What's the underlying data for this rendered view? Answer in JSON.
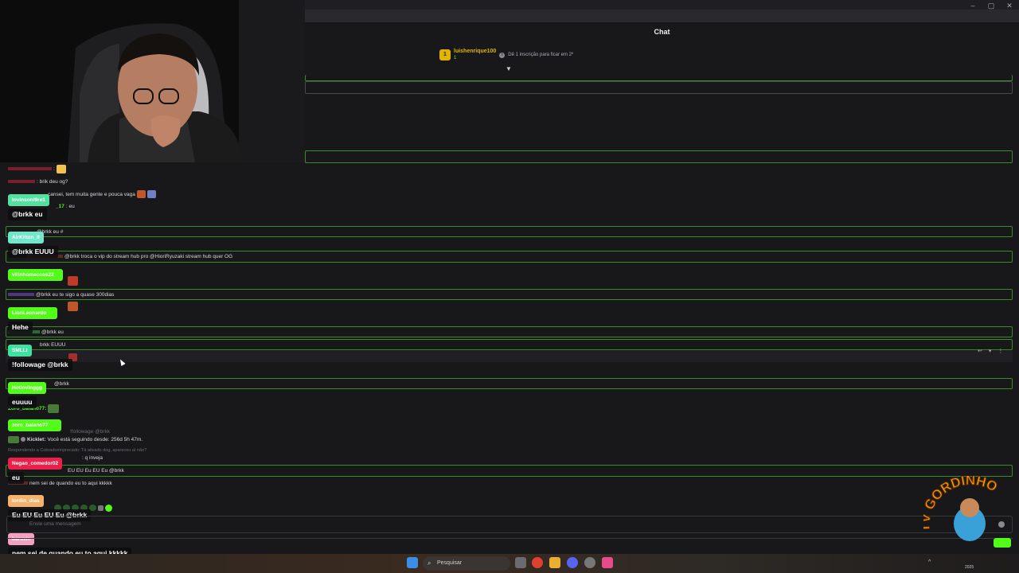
{
  "window": {
    "minimize_glyph": "–",
    "maximize_glyph": "▢",
    "close_glyph": "✕"
  },
  "chat": {
    "header": "Chat",
    "pinned": {
      "rank": "1",
      "username": "luishenrique100",
      "count": "1",
      "text": "Dê 1 inscrição para ficar em 2º"
    },
    "input_placeholder": "Envie uma mensagem",
    "messages": [
      {
        "user": "",
        "text": ":",
        "color": "#e94560"
      },
      {
        "user": "",
        "text": ": brik deu og?",
        "color": "#e94560"
      },
      {
        "user": "",
        "text": "cansei, tem muita gente e pouca vaga",
        "color": "#9a9aa0"
      },
      {
        "user": "_17",
        "text": ": eu",
        "color": "#53fc18"
      },
      {
        "user": "",
        "text": "@brkk eu #",
        "color": "#9a9aa0"
      },
      {
        "user": "",
        "text": "@brkk troca o vip do stream hub pro @HioriRyuzaki stream hub quer OG",
        "color": "#c85a5a"
      },
      {
        "user": "",
        "text": "@brkk eu te sigo a quase 300dias",
        "color": "#8a6fd8"
      },
      {
        "user": "",
        "text": "@brkk eu",
        "color": "#53fc18"
      },
      {
        "user": "",
        "text": "brkk EUUU",
        "color": "#53fc18"
      },
      {
        "user": "",
        "text": "@brkk",
        "color": "#53fc18"
      },
      {
        "user": "Zoro_baiano77:",
        "text": "",
        "color": "#53fc18"
      },
      {
        "user": "",
        "text": "!followage @brkk",
        "color": "#6b6b70"
      },
      {
        "user": "Kicklet:",
        "text": "Você está seguindo desde: 256d 5h 47m.",
        "color": "#d8d8dc"
      },
      {
        "user": "",
        "text": "Respondendo a Cobradorimprecado: Tá ativado dog, apareceu aí não?",
        "color": "#6b6b70"
      },
      {
        "user": "",
        "text": ": q inveja",
        "color": "#6b6b70"
      },
      {
        "user": "",
        "text": "EU EU Eu EU Eu @brkk",
        "color": "#d8d8dc"
      },
      {
        "user": "",
        "text": "nem sei de quando eu to aqui kkkkk",
        "color": "#d8d8dc"
      }
    ]
  },
  "overlay": [
    {
      "name": "lovinsonl9re1",
      "msg": "@brkk eu",
      "color": "#53e0a0"
    },
    {
      "name": "AIrKilton_II",
      "msg": "@brkk EUUU",
      "color": "#6fe7c8"
    },
    {
      "name": "vitinhomeccos22",
      "msg": "",
      "color": "#53fc18"
    },
    {
      "name": "LionLeonardo",
      "msg": "Hehe",
      "color": "#53fc18"
    },
    {
      "name": "SMLLI",
      "msg": "!followage @brkk",
      "color": "#3fe0a0"
    },
    {
      "name": "Hotlovinggg",
      "msg": "euuuu",
      "color": "#53fc18"
    },
    {
      "name": "zoro_baiano77",
      "msg": "",
      "color": "#53fc18"
    },
    {
      "name": "Negao_comedor02",
      "msg": "eu",
      "color": "#e8204a"
    },
    {
      "name": "lordin_dias",
      "msg": "Eu EU Eu EU Eu @brkk",
      "color": "#f6b26b"
    },
    {
      "name": "baruxin",
      "msg": "nem sei de quando eu to aqui kkkkk",
      "color": "#f4a0c0"
    }
  ],
  "taskbar": {
    "search_placeholder": "Pesquisar",
    "year": "2025"
  },
  "logo": {
    "text": "TV GORDINHO"
  },
  "colors": {
    "kick_green": "#53fc18",
    "highlight_border": "#3c8a2a",
    "bg": "#18181b"
  }
}
